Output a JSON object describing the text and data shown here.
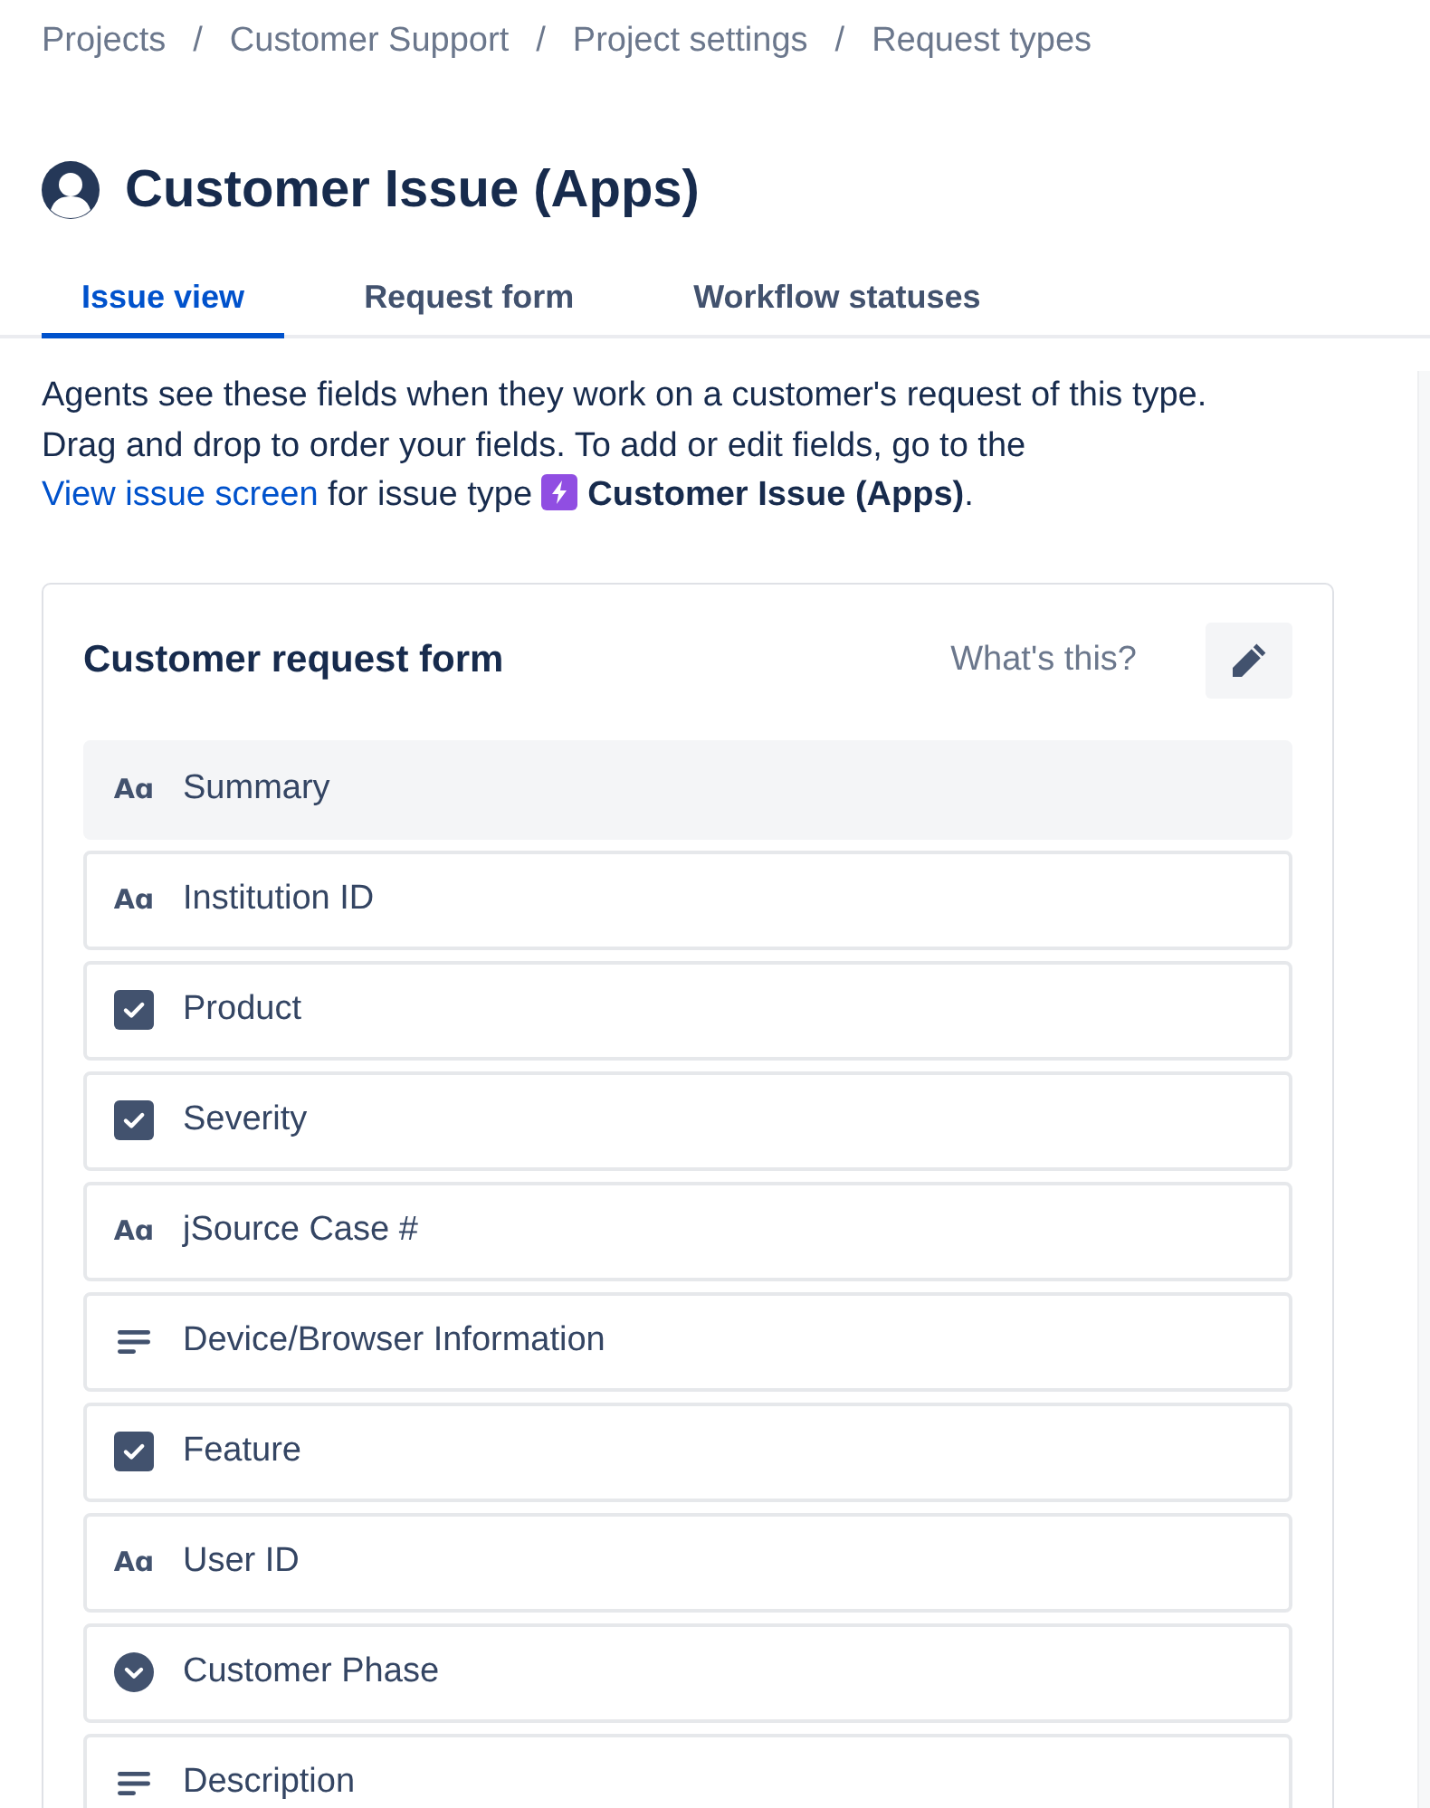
{
  "breadcrumbs": {
    "items": [
      "Projects",
      "Customer Support",
      "Project settings",
      "Request types"
    ],
    "separators": [
      "/",
      "/",
      "/"
    ]
  },
  "page_title": "Customer Issue (Apps)",
  "tabs": [
    {
      "label": "Issue view",
      "selected": true
    },
    {
      "label": "Request form",
      "selected": false
    },
    {
      "label": "Workflow statuses",
      "selected": false
    }
  ],
  "intro": {
    "text": "Agents see these fields when they work on a customer's request of this type. Drag and drop to order your fields. To add or edit fields, go to the",
    "link": "View issue screen",
    "text_after": "for issue type",
    "issue_type": "**Customer Issue (Apps)**."
  },
  "form": {
    "title": "Customer request form",
    "help_link": "What's this?",
    "fields": [
      {
        "kind": "text",
        "glyph": "Aɑ",
        "label": "Summary",
        "highlighted": true
      },
      {
        "kind": "text",
        "glyph": "Aɑ",
        "label": "Institution ID",
        "highlighted": false
      },
      {
        "kind": "checkbox",
        "label": "Product",
        "highlighted": false
      },
      {
        "kind": "checkbox",
        "label": "Severity",
        "highlighted": false
      },
      {
        "kind": "text",
        "glyph": "Aɑ",
        "label": "jSource Case #",
        "highlighted": false
      },
      {
        "kind": "paragraph",
        "label": "Device/Browser Information",
        "highlighted": false
      },
      {
        "kind": "checkbox",
        "label": "Feature",
        "highlighted": false
      },
      {
        "kind": "text",
        "glyph": "Aɑ",
        "label": "User ID",
        "highlighted": false
      },
      {
        "kind": "select",
        "label": "Customer Phase",
        "highlighted": false
      },
      {
        "kind": "paragraph",
        "label": "Description",
        "highlighted": false
      }
    ]
  }
}
